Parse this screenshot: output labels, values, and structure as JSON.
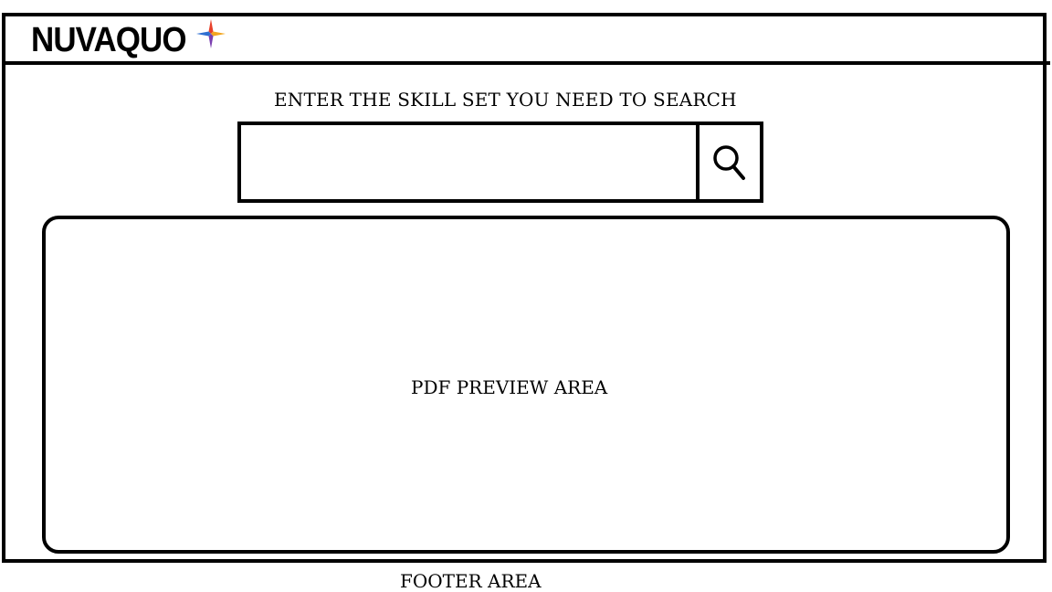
{
  "header": {
    "logo_text": "NUVAQUO",
    "logo_icon": "four-point-star-logo",
    "logo_colors": [
      "#e8402a",
      "#2e6fd1",
      "#f2a51f",
      "#7a3fb0"
    ]
  },
  "search": {
    "label": "ENTER THE SKILL SET YOU NEED TO SEARCH",
    "value": "",
    "placeholder": "",
    "button_icon": "search-icon"
  },
  "preview": {
    "label": "PDF PREVIEW AREA"
  },
  "footer": {
    "label": "FOOTER AREA"
  }
}
